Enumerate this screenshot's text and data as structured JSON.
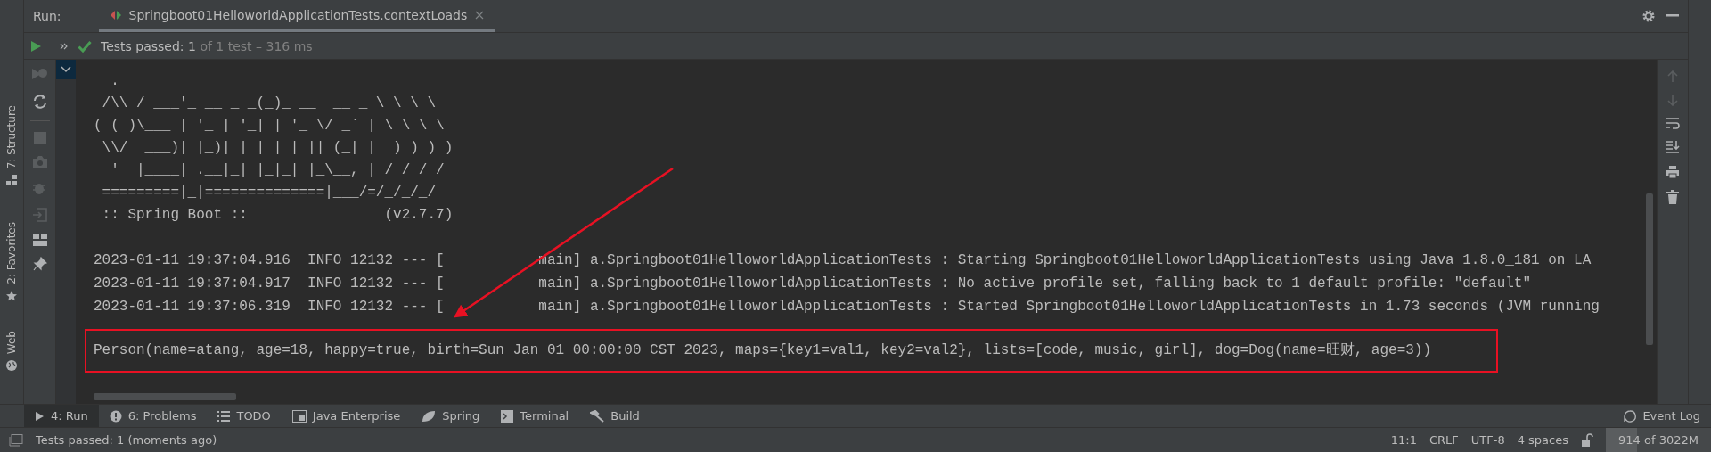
{
  "run_header": {
    "label": "Run:",
    "tab": {
      "title": "Springboot01HelloworldApplicationTests.contextLoads",
      "selected": true
    }
  },
  "test_status": {
    "passed": "Tests passed: 1",
    "detail": "of 1 test – 316 ms"
  },
  "side_tool_tabs": [
    {
      "label": "7: Structure"
    },
    {
      "label": "2: Favorites"
    },
    {
      "label": "Web"
    }
  ],
  "console": {
    "banner": [
      "  .   ____          _            __ _ _",
      " /\\\\ / ___'_ __ _ _(_)_ __  __ _ \\ \\ \\ \\",
      "( ( )\\___ | '_ | '_| | '_ \\/ _` | \\ \\ \\ \\",
      " \\\\/  ___)| |_)| | | | | || (_| |  ) ) ) )",
      "  '  |____| .__|_| |_|_| |_\\__, | / / / /",
      " =========|_|==============|___/=/_/_/_/",
      " :: Spring Boot ::                (v2.7.7)"
    ],
    "log_lines": [
      "2023-01-11 19:37:04.916  INFO 12132 --- [           main] a.Springboot01HelloworldApplicationTests : Starting Springboot01HelloworldApplicationTests using Java 1.8.0_181 on LA",
      "2023-01-11 19:37:04.917  INFO 12132 --- [           main] a.Springboot01HelloworldApplicationTests : No active profile set, falling back to 1 default profile: \"default\"",
      "2023-01-11 19:37:06.319  INFO 12132 --- [           main] a.Springboot01HelloworldApplicationTests : Started Springboot01HelloworldApplicationTests in 1.73 seconds (JVM running"
    ],
    "highlighted_output": "Person(name=atang, age=18, happy=true, birth=Sun Jan 01 00:00:00 CST 2023, maps={key1=val1, key2=val2}, lists=[code, music, girl], dog=Dog(name=旺财, age=3))"
  },
  "bottom_tool_tabs": [
    {
      "label": "4: Run",
      "selected": true
    },
    {
      "label": "6: Problems",
      "selected": false
    },
    {
      "label": "TODO",
      "selected": false
    },
    {
      "label": "Java Enterprise",
      "selected": false
    },
    {
      "label": "Spring",
      "selected": false
    },
    {
      "label": "Terminal",
      "selected": false
    },
    {
      "label": "Build",
      "selected": false
    }
  ],
  "event_log": "Event Log",
  "status_bar": {
    "message": "Tests passed: 1 (moments ago)",
    "items": [
      "11:1",
      "CRLF",
      "UTF-8",
      "4 spaces"
    ],
    "memory": {
      "text": "914 of 3022M",
      "level": 0.3
    }
  }
}
